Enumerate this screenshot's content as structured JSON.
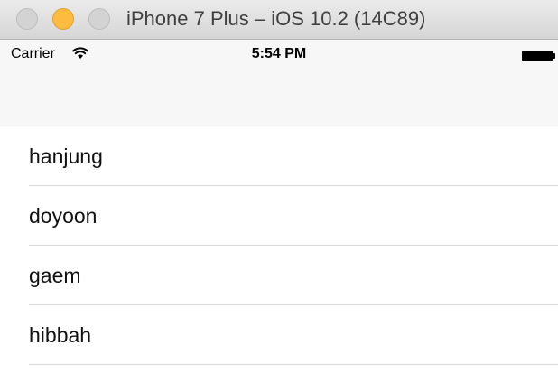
{
  "window": {
    "title": "iPhone 7 Plus – iOS 10.2 (14C89)"
  },
  "status_bar": {
    "carrier": "Carrier",
    "time": "5:54 PM",
    "wifi_icon": "wifi-icon",
    "battery_icon": "battery-icon",
    "battery_level": 1.0
  },
  "navigation_bar": {},
  "table": {
    "rows": [
      {
        "label": "hanjung"
      },
      {
        "label": "doyoon"
      },
      {
        "label": "gaem"
      },
      {
        "label": "hibbah"
      }
    ]
  },
  "colors": {
    "minimize_button": "#fdbc40",
    "inactive_button": "#d3d3d3"
  }
}
